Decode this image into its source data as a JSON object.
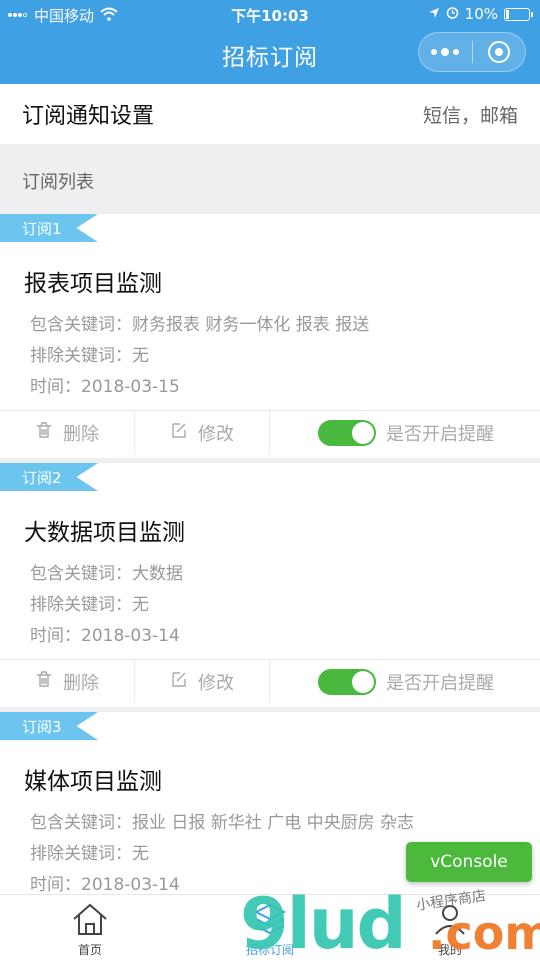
{
  "status": {
    "carrier": "中国移动",
    "time": "下午10:03",
    "battery": "10%"
  },
  "header": {
    "title": "招标订阅"
  },
  "settings": {
    "label": "订阅通知设置",
    "value": "短信，邮箱"
  },
  "section": {
    "title": "订阅列表"
  },
  "subscriptions": [
    {
      "tag": "订阅1",
      "title": "报表项目监测",
      "include": "包含关键词：财务报表 财务一体化 报表 报送",
      "exclude": "排除关键词：无",
      "time": "时间：2018-03-15",
      "delete_label": "删除",
      "edit_label": "修改",
      "remind_label": "是否开启提醒",
      "remind_on": true
    },
    {
      "tag": "订阅2",
      "title": "大数据项目监测",
      "include": "包含关键词：大数据",
      "exclude": "排除关键词：无",
      "time": "时间：2018-03-14",
      "delete_label": "删除",
      "edit_label": "修改",
      "remind_label": "是否开启提醒",
      "remind_on": true
    },
    {
      "tag": "订阅3",
      "title": "媒体项目监测",
      "include": "包含关键词：报业 日报 新华社 广电 中央厨房 杂志",
      "exclude": "排除关键词：无",
      "time": "时间：2018-03-14"
    }
  ],
  "vconsole": {
    "label": "vConsole"
  },
  "tabbar": {
    "home": "首页",
    "subscribe": "招标订阅",
    "mine": "我的"
  },
  "watermark": {
    "brand": "9lud",
    "domain": ".com",
    "tagline": "小程序商店"
  },
  "colors": {
    "primary": "#3fa0e3",
    "ribbon": "#6cc5ef",
    "toggle": "#49b83f",
    "vconsole": "#4cb93d"
  }
}
